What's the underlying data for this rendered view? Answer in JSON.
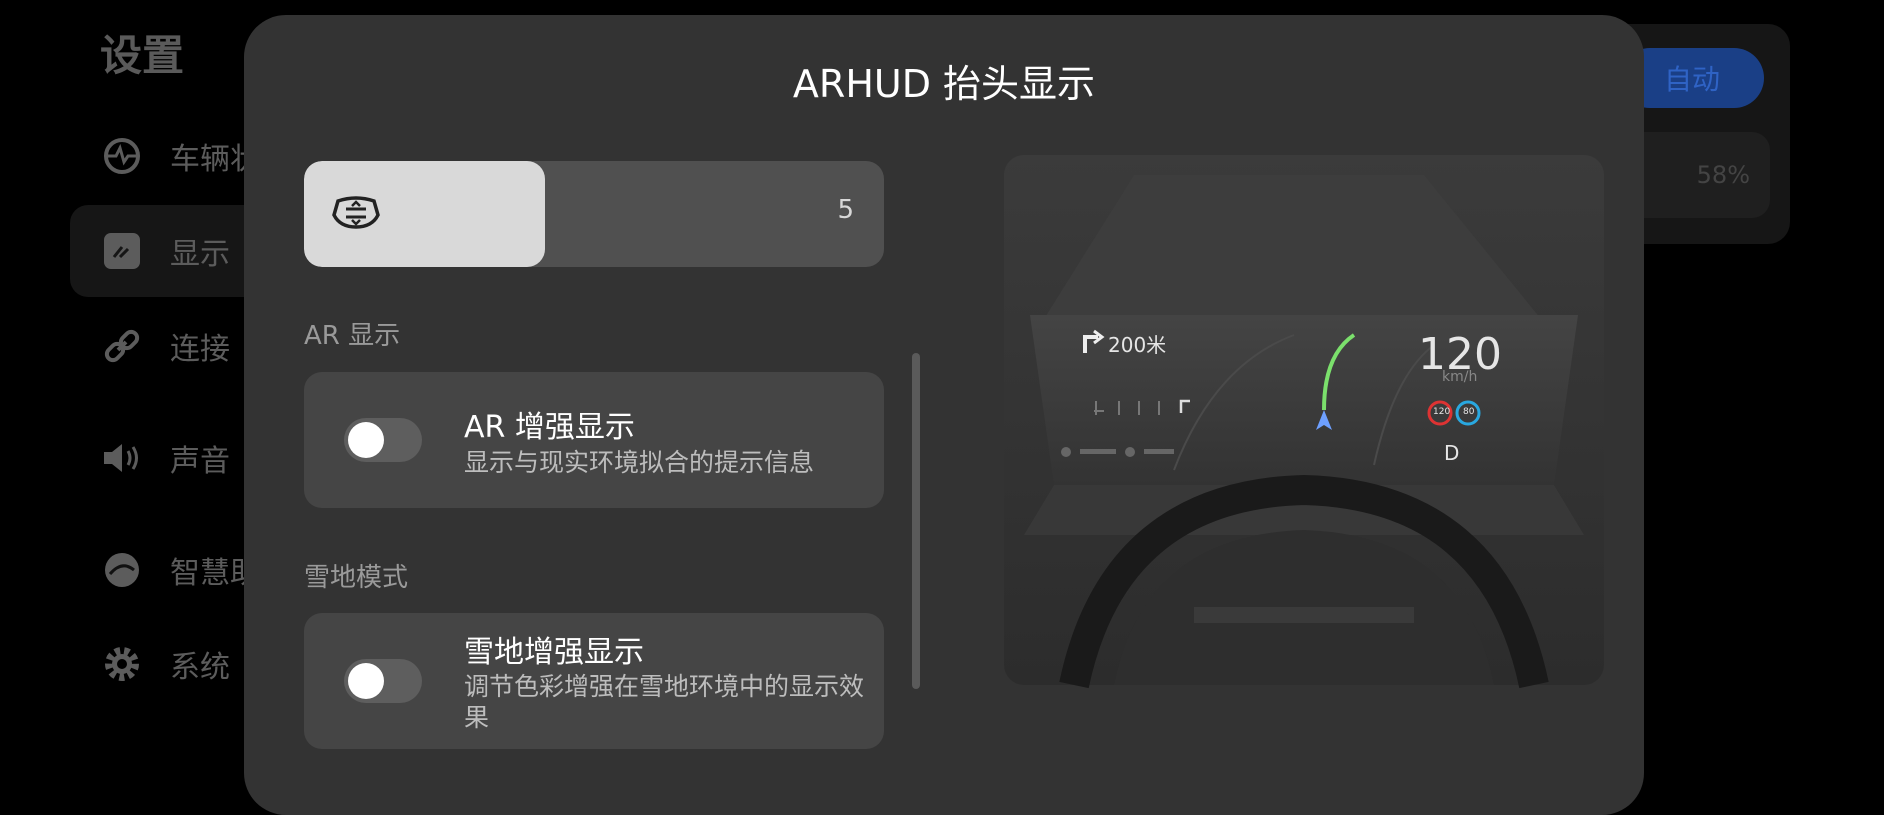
{
  "background": {
    "title": "设置",
    "nav": [
      {
        "label": "车辆状",
        "icon": "steering-wheel-icon"
      },
      {
        "label": "显示",
        "icon": "display-icon",
        "active": true
      },
      {
        "label": "连接",
        "icon": "link-icon"
      },
      {
        "label": "声音",
        "icon": "speaker-icon"
      },
      {
        "label": "智慧助",
        "icon": "assistant-icon"
      },
      {
        "label": "系统",
        "icon": "gear-icon"
      }
    ],
    "auto_button": "自动",
    "percent": "58%"
  },
  "modal": {
    "title": "ARHUD 抬头显示",
    "brightness": {
      "icon": "hud-height-icon",
      "value": "5",
      "level_fraction": 0.415
    },
    "sections": [
      {
        "label": "AR 显示",
        "item": {
          "title": "AR 增强显示",
          "description": "显示与现实环境拟合的提示信息",
          "enabled": false
        }
      },
      {
        "label": "雪地模式",
        "item": {
          "title": "雪地增强显示",
          "description": "调节色彩增强在雪地环境中的显示效果",
          "enabled": false
        }
      }
    ]
  },
  "preview": {
    "distance": "200米",
    "speed": "120",
    "speed_unit": "km/h",
    "limits": [
      "120",
      "80"
    ],
    "gear": "D"
  },
  "colors": {
    "accent": "#1a3f86",
    "modal_bg": "#333333",
    "card_bg": "#454545",
    "route": "#7be06c",
    "nav_arrow": "#6ea0ff"
  }
}
